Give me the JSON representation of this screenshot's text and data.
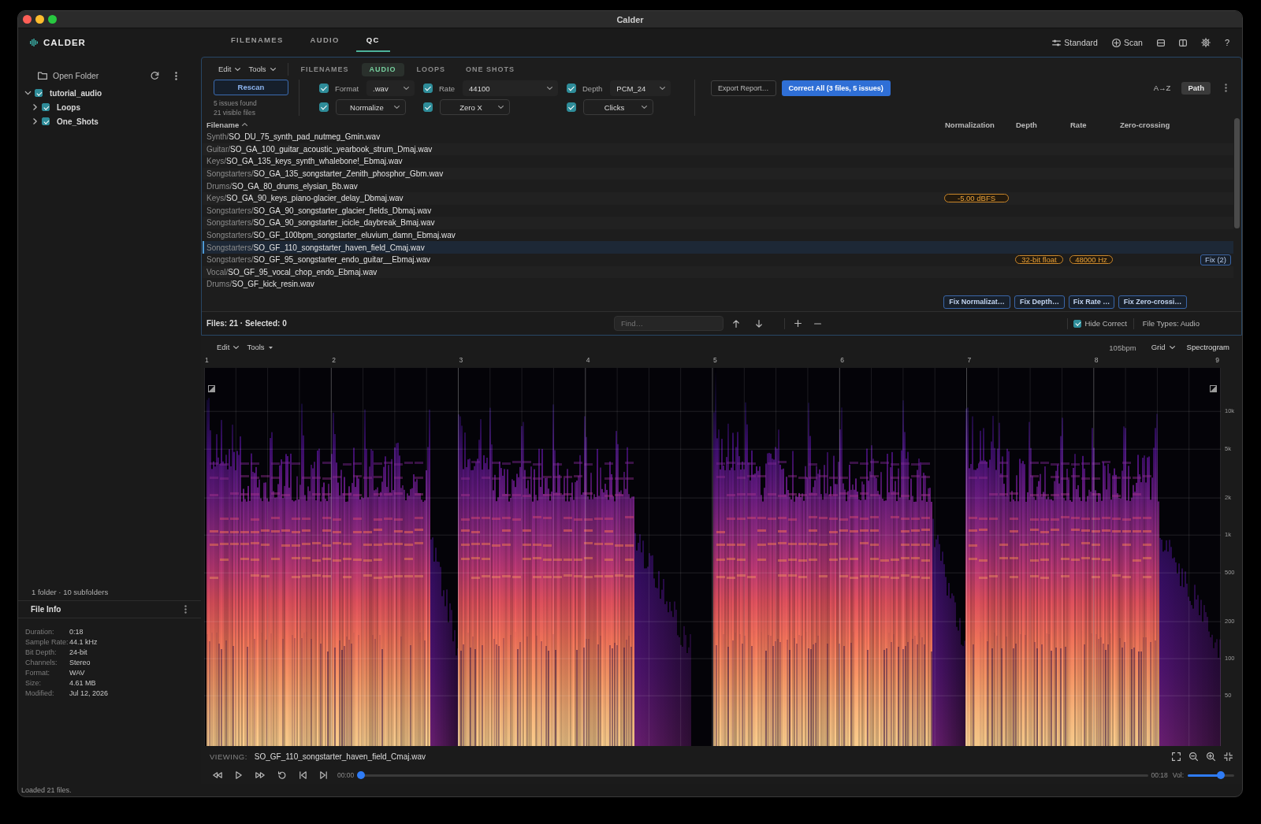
{
  "window": {
    "title": "Calder"
  },
  "app": {
    "name": "CALDER"
  },
  "nav_tabs": [
    {
      "label": "FILENAMES",
      "selected": false
    },
    {
      "label": "AUDIO",
      "selected": false
    },
    {
      "label": "QC",
      "selected": true
    }
  ],
  "header": {
    "standard_button": "Standard",
    "scan_button": "Scan",
    "help_button": "?"
  },
  "sidebar": {
    "open_folder_button": "Open Folder",
    "tree": [
      {
        "label": "tutorial_audio",
        "checked": true,
        "expanded": true,
        "children": [
          {
            "label": "Loops",
            "checked": true,
            "expanded": false
          },
          {
            "label": "One_Shots",
            "checked": true,
            "expanded": false
          }
        ]
      }
    ],
    "summary": "1 folder · 10 subfolders",
    "file_info": {
      "title": "File Info",
      "fields": [
        {
          "label": "Duration:",
          "value": "0:18"
        },
        {
          "label": "Sample Rate:",
          "value": "44.1 kHz"
        },
        {
          "label": "Bit Depth:",
          "value": "24-bit"
        },
        {
          "label": "Channels:",
          "value": "Stereo"
        },
        {
          "label": "Format:",
          "value": "WAV"
        },
        {
          "label": "Size:",
          "value": "4.61 MB"
        },
        {
          "label": "Modified:",
          "value": "Jul 12, 2026"
        }
      ]
    }
  },
  "qc_panel": {
    "menus": [
      "Edit",
      "Tools"
    ],
    "tabs": [
      {
        "label": "FILENAMES",
        "selected": false
      },
      {
        "label": "AUDIO",
        "selected": true
      },
      {
        "label": "LOOPS",
        "selected": false
      },
      {
        "label": "ONE SHOTS",
        "selected": false
      }
    ],
    "rescan_button": "Rescan",
    "issues_summary": "5 issues found",
    "visible_summary": "21 visible files",
    "filters": [
      {
        "label": "Format",
        "checked": true,
        "value": ".wav"
      },
      {
        "label": "Rate",
        "checked": true,
        "value": "44100"
      },
      {
        "label": "Depth",
        "checked": true,
        "value": "PCM_24"
      },
      {
        "checked": true,
        "value": "Normalize"
      },
      {
        "checked": true,
        "value": "Zero X"
      },
      {
        "checked": true,
        "value": "Clicks"
      }
    ],
    "export_button": "Export Report…",
    "correct_all_button": "Correct All (3 files, 5 issues)",
    "sort_options": [
      {
        "label": "A→Z",
        "selected": false
      },
      {
        "label": "Path",
        "selected": true
      }
    ],
    "table": {
      "columns": [
        "Filename",
        "Normalization",
        "Depth",
        "Rate",
        "Zero-crossing"
      ],
      "rows": [
        {
          "folder": "Synth/",
          "file": "SO_DU_75_synth_pad_nutmeg_Gmin.wav",
          "selected": false
        },
        {
          "folder": "Guitar/",
          "file": "SO_GA_100_guitar_acoustic_yearbook_strum_Dmaj.wav",
          "selected": false
        },
        {
          "folder": "Keys/",
          "file": "SO_GA_135_keys_synth_whalebone!_Ebmaj.wav",
          "selected": false
        },
        {
          "folder": "Songstarters/",
          "file": "SO_GA_135_songstarter_Zenith_phosphor_Gbm.wav",
          "selected": false
        },
        {
          "folder": "Drums/",
          "file": "SO_GA_80_drums_elysian_Bb.wav",
          "selected": false
        },
        {
          "folder": "Keys/",
          "file": "SO_GA_90_keys_piano-glacier_delay_Dbmaj.wav",
          "selected": false,
          "normalization": "-5.00 dBFS"
        },
        {
          "folder": "Songstarters/",
          "file": "SO_GA_90_songstarter_glacier_fields_Dbmaj.wav",
          "selected": false
        },
        {
          "folder": "Songstarters/",
          "file": "SO_GA_90_songstarter_icicle_daybreak_Bmaj.wav",
          "selected": false
        },
        {
          "folder": "Songstarters/",
          "file": "SO_GF_100bpm_songstarter_eluvium_damn_Ebmaj.wav",
          "selected": false
        },
        {
          "folder": "Songstarters/",
          "file": "SO_GF_110_songstarter_haven_field_Cmaj.wav",
          "selected": true
        },
        {
          "folder": "Songstarters/",
          "file": "SO_GF_95_songstarter_endo_guitar__Ebmaj.wav",
          "selected": false,
          "depth": "32-bit float",
          "rate": "48000 Hz",
          "fix_button": "Fix (2)"
        },
        {
          "folder": "Vocal/",
          "file": "SO_GF_95_vocal_chop_endo_Ebmaj.wav",
          "selected": false
        },
        {
          "folder": "Drums/",
          "file": "SO_GF_kick_resin.wav",
          "selected": false
        }
      ]
    },
    "fix_buttons": [
      "Fix Normalizat…",
      "Fix Depth…",
      "Fix Rate …",
      "Fix Zero-crossi…"
    ],
    "status": {
      "counts": "Files: 21 · Selected: 0",
      "find_placeholder": "Find…",
      "hide_correct": {
        "label": "Hide Correct",
        "checked": true
      },
      "file_types": "File Types: Audio"
    }
  },
  "audio_panel": {
    "menus": [
      "Edit",
      "Tools"
    ],
    "tempo": "105bpm",
    "grid_menu": "Grid",
    "view_menu": "Spectrogram",
    "bar_numbers": [
      "1",
      "2",
      "3",
      "4",
      "5",
      "6",
      "7",
      "8",
      "9"
    ],
    "frequency_labels": [
      "10k",
      "5k",
      "2k",
      "1k",
      "500",
      "200",
      "100",
      "50"
    ],
    "viewing_label": "VIEWING:",
    "viewing_file": "SO_GF_110_songstarter_haven_field_Cmaj.wav",
    "position": {
      "current": "00:00",
      "total": "00:18",
      "level": 0
    },
    "volume": {
      "label": "Vol:",
      "level": 0.71
    }
  },
  "status_bar": "Loaded 21 files."
}
